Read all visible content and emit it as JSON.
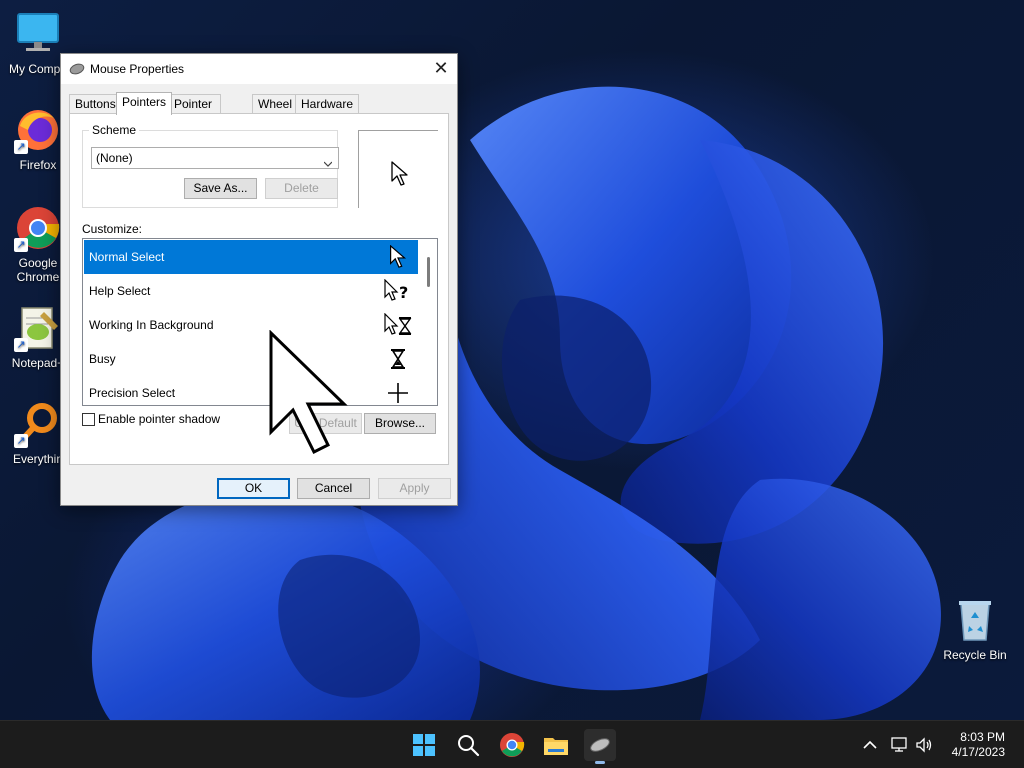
{
  "desktop": {
    "icons": [
      {
        "label": "My Compu"
      },
      {
        "label": "Firefox"
      },
      {
        "label": "Google"
      },
      {
        "label": "Chrome"
      },
      {
        "label": "Notepad+"
      },
      {
        "label": "Everythin"
      },
      {
        "label": "Recycle Bin"
      }
    ]
  },
  "dialog": {
    "title": "Mouse Properties",
    "tabs": [
      {
        "label": "Buttons"
      },
      {
        "label": "Pointers"
      },
      {
        "label": "Pointer Options"
      },
      {
        "label": "Wheel"
      },
      {
        "label": "Hardware"
      }
    ],
    "active_tab": "Pointers",
    "scheme": {
      "label": "Scheme",
      "selected": "(None)",
      "save_as_label": "Save As...",
      "delete_label": "Delete"
    },
    "customize_label": "Customize:",
    "cursor_list": [
      {
        "label": "Normal Select",
        "icon": "arrow-cursor-icon",
        "selected": true
      },
      {
        "label": "Help Select",
        "icon": "help-cursor-icon",
        "selected": false
      },
      {
        "label": "Working In Background",
        "icon": "working-cursor-icon",
        "selected": false
      },
      {
        "label": "Busy",
        "icon": "hourglass-cursor-icon",
        "selected": false
      },
      {
        "label": "Precision Select",
        "icon": "crosshair-cursor-icon",
        "selected": false
      }
    ],
    "enable_shadow_label": "Enable pointer shadow",
    "enable_shadow_checked": false,
    "use_default_label": "Use Default",
    "browse_label": "Browse...",
    "ok_label": "OK",
    "cancel_label": "Cancel",
    "apply_label": "Apply"
  },
  "taskbar": {
    "time": "8:03 PM",
    "date": "4/17/2023",
    "apps": [
      "start-icon",
      "search-icon",
      "chrome-icon",
      "file-explorer-icon",
      "mouse-properties-icon"
    ]
  },
  "colors": {
    "selection": "#0078d7",
    "taskbar": "#1c1c1c",
    "dialog_bg": "#f0f0f0"
  }
}
